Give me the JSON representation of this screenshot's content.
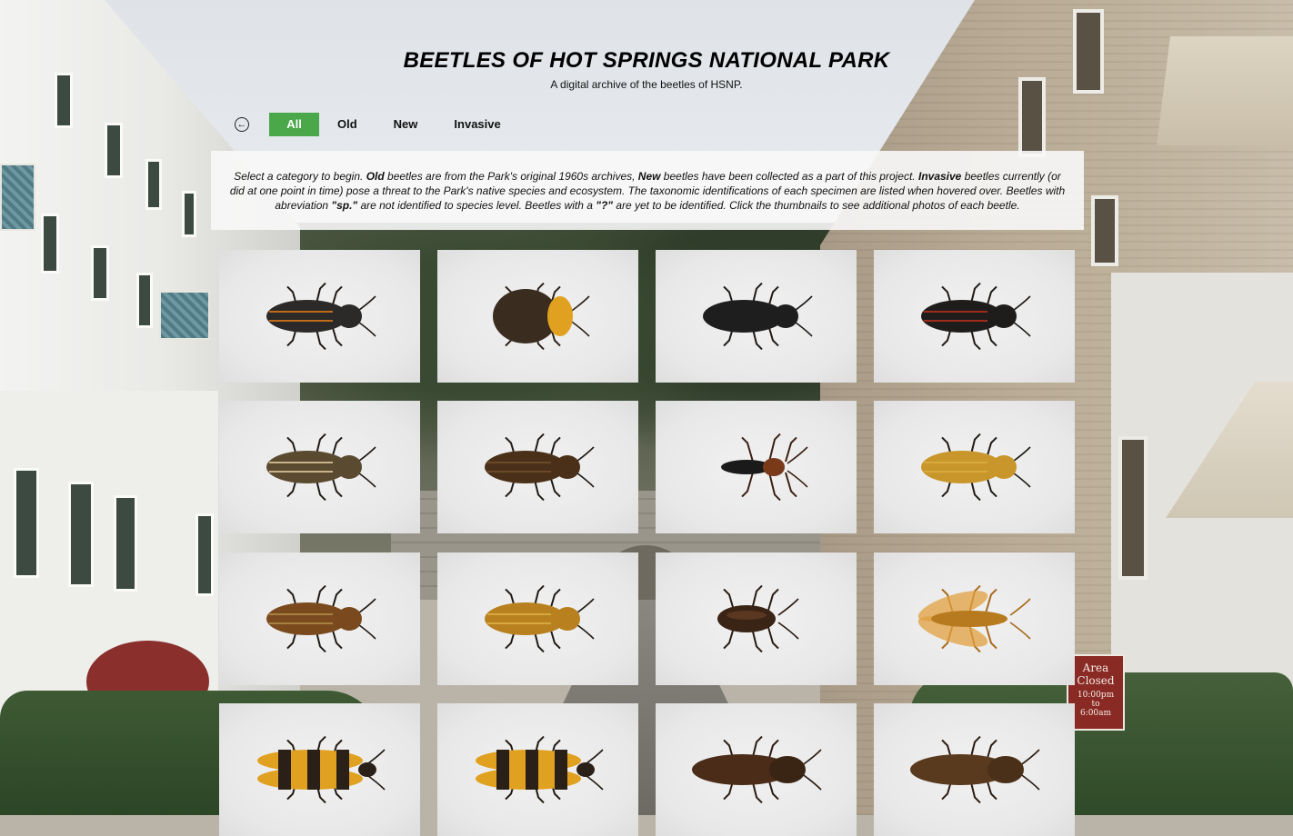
{
  "header": {
    "title": "BEETLES OF HOT SPRINGS NATIONAL PARK",
    "subtitle": "A digital archive of the beetles of HSNP."
  },
  "nav": {
    "back_icon": "arrow-left-circle-icon",
    "tabs": [
      {
        "label": "All",
        "active": true
      },
      {
        "label": "Old",
        "active": false
      },
      {
        "label": "New",
        "active": false
      },
      {
        "label": "Invasive",
        "active": false
      }
    ],
    "active_color": "#4aa74a"
  },
  "info": {
    "t1": "Select a category to begin. ",
    "b1": "Old",
    "t2": " beetles are from the Park's original 1960s archives, ",
    "b2": "New",
    "t3": " beetles have been collected as a part of this project. ",
    "b3": "Invasive",
    "t4": " beetles currently (or did at one point in time) pose a threat to the Park's native species and ecosystem. The taxonomic identifications of each specimen are listed when hovered over. Beetles with abreviation ",
    "b4": "\"sp.\"",
    "t5": " are not identified to species level. Beetles with a ",
    "b5": "\"?\"",
    "t6": " are yet to be identified. Click the thumbnails to see additional photos of each beetle."
  },
  "background_sign": {
    "lines": [
      "Area",
      "Closed",
      "10:00pm",
      "to",
      "6:00am"
    ]
  },
  "thumbnails": [
    {
      "body": "#2b2a28",
      "accent": "#c06a1a",
      "shape": "long"
    },
    {
      "body": "#3a2c1e",
      "accent": "#e0a020",
      "shape": "round"
    },
    {
      "body": "#1e1e1e",
      "accent": "#1e1e1e",
      "shape": "long"
    },
    {
      "body": "#1f1d1c",
      "accent": "#a02a1a",
      "shape": "long"
    },
    {
      "body": "#5a4a30",
      "accent": "#c9b38a",
      "shape": "long"
    },
    {
      "body": "#4a3018",
      "accent": "#6a4a28",
      "shape": "long"
    },
    {
      "body": "#1a1a1a",
      "accent": "#7a3a1a",
      "shape": "slim"
    },
    {
      "body": "#c8962a",
      "accent": "#d8aa40",
      "shape": "long"
    },
    {
      "body": "#7a4a1e",
      "accent": "#a88040",
      "shape": "long"
    },
    {
      "body": "#b8801e",
      "accent": "#d8a840",
      "shape": "long"
    },
    {
      "body": "#3a2416",
      "accent": "#7a4a2a",
      "shape": "short"
    },
    {
      "body": "#b87a1e",
      "accent": "#e0a040",
      "shape": "winged"
    },
    {
      "body": "#e0a020",
      "accent": "#2a2018",
      "shape": "banded"
    },
    {
      "body": "#e0a020",
      "accent": "#2a2018",
      "shape": "banded"
    },
    {
      "body": "#4a2c18",
      "accent": "#3a2414",
      "shape": "click"
    },
    {
      "body": "#5a3a1e",
      "accent": "#4a3018",
      "shape": "click"
    }
  ]
}
